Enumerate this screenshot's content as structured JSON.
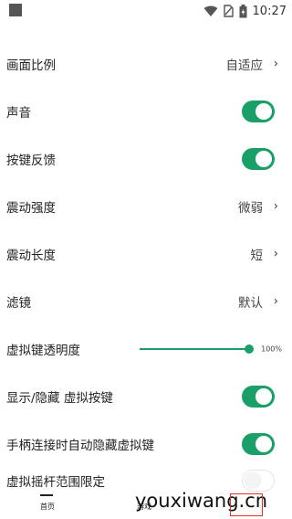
{
  "status_bar": {
    "time": "10:27"
  },
  "settings": [
    {
      "label": "画面比例",
      "value": "自适应",
      "type": "select"
    },
    {
      "label": "声音",
      "type": "toggle",
      "on": true
    },
    {
      "label": "按键反馈",
      "type": "toggle",
      "on": true
    },
    {
      "label": "震动强度",
      "value": "微弱",
      "type": "select"
    },
    {
      "label": "震动长度",
      "value": "短",
      "type": "select"
    },
    {
      "label": "滤镜",
      "value": "默认",
      "type": "select"
    },
    {
      "label": "虚拟键透明度",
      "type": "slider",
      "value_text": "100%",
      "level": 1.0
    },
    {
      "label": "显示/隐藏 虚拟按键",
      "type": "toggle",
      "on": true
    },
    {
      "label": "手柄连接时自动隐藏虚拟键",
      "type": "toggle",
      "on": true
    },
    {
      "label": "虚拟摇杆范围限定",
      "type": "toggle",
      "on": false
    }
  ],
  "bottom_nav": {
    "home_label": "首页",
    "second_label": "游戏"
  },
  "watermark": "youxiwang.cn",
  "colors": {
    "accent": "#1a9f68",
    "highlight_box": "#e0312a"
  }
}
